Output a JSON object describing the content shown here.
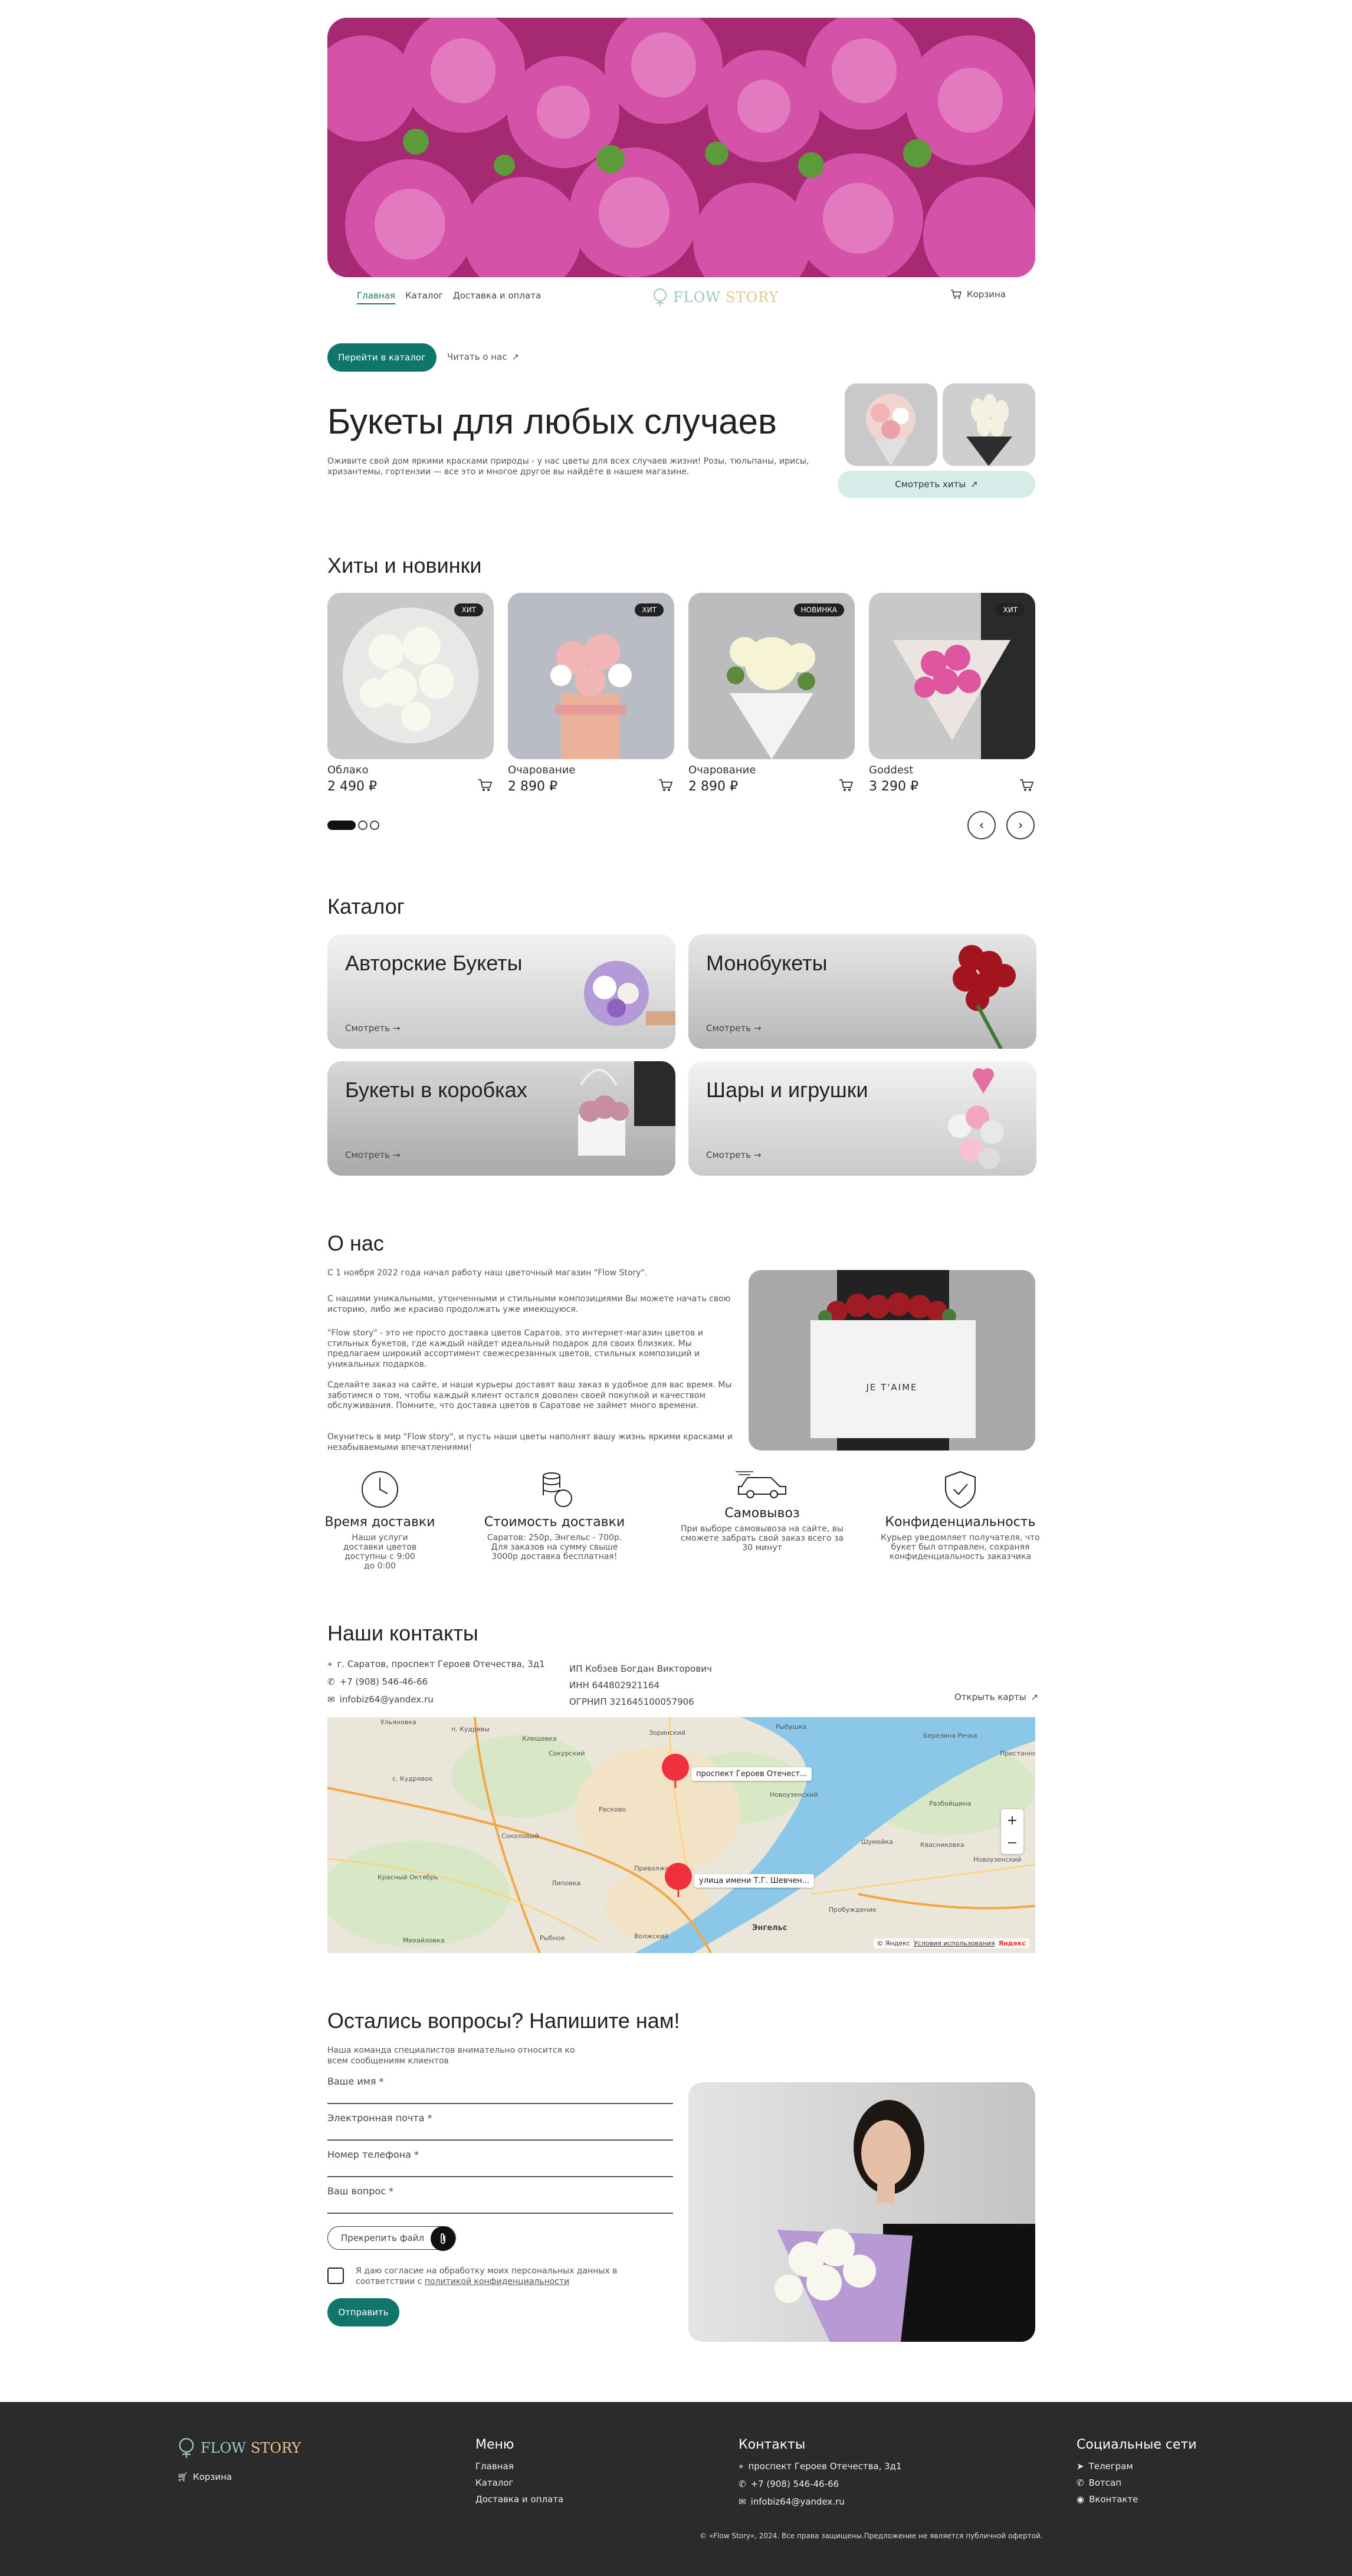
{
  "nav": {
    "items": [
      "Главная",
      "Каталог",
      "Доставка и оплата"
    ],
    "logo_flow": "FLOW",
    "logo_story": "STORY",
    "cart": "Корзина"
  },
  "hero": {
    "catalog_button": "Перейти в каталог",
    "about_link": "Читать о нас",
    "title": "Букеты для любых случаев",
    "subtitle": "Оживите свой дом яркими красками природы - у нас цветы для всех случаев жизни! Розы, тюльпаны, ирисы, хризантемы, гортензии — все это и многое другое вы найдёте в нашем магазине.",
    "hits_button": "Смотреть хиты"
  },
  "hits": {
    "title": "Хиты и новинки",
    "products": [
      {
        "name": "Облако",
        "price": "2 490 ₽",
        "badge": "ХИТ"
      },
      {
        "name": "Очарование",
        "price": "2 890 ₽",
        "badge": "ХИТ"
      },
      {
        "name": "Очарование",
        "price": "2 890 ₽",
        "badge": "НОВИНКА"
      },
      {
        "name": "Goddest",
        "price": "3 290 ₽",
        "badge": "ХИТ"
      }
    ]
  },
  "catalog": {
    "title": "Каталог",
    "link": "Смотреть",
    "categories": [
      "Авторские Букеты",
      "Монобукеты",
      "Букеты в коробках",
      "Шары и игрушки"
    ]
  },
  "about": {
    "title": "О нас",
    "p1": "С 1 ноября 2022 года начал работу наш цветочный магазин \"Flow Story\".",
    "p2": "С нашими уникальными, утонченными и стильными композициями Вы можете начать свою историю, либо же красиво продолжать уже имеющуюся.",
    "p3": "\"Flow story\" - это не просто доставка цветов Саратов, это интернет-магазин цветов и стильных букетов, где каждый найдет идеальный подарок для своих близких. Мы предлагаем широкий ассортимент свежесрезанных цветов, стильных композиций и уникальных подарков.",
    "p4": "Сделайте заказ на сайте, и наши курьеры доставят ваш заказ в удобное для вас время. Мы заботимся о том, чтобы каждый клиент остался доволен своей покупкой и качеством обслуживания. Помните, что доставка цветов в Саратове не займет много времени.",
    "p5": "Окунитесь в мир \"Flow story\", и пусть наши цветы наполнят вашу жизнь яркими красками и незабываемыми впечатлениями!",
    "box_text": "JE T'AIME",
    "features": [
      {
        "title": "Время доставки",
        "desc": "Наши услуги доставки цветов доступны с 9:00 до 0:00"
      },
      {
        "title": "Стоимость доставки",
        "desc": "Саратов: 250р, Энгельс - 700р. Для заказов на сумму свыше 3000р доставка бесплатная!"
      },
      {
        "title": "Самовывоз",
        "desc": "При выборе самовывоза на сайте, вы сможете забрать свой заказ всего за 30 минут"
      },
      {
        "title": "Конфиденциальность",
        "desc": "Курьер уведомляет получателя, что букет был отправлен, сохраняя конфиденциальность заказчика"
      }
    ]
  },
  "contacts": {
    "title": "Наши контакты",
    "address": "г. Саратов, проспект Героев Отечества, 3д1",
    "phone": "+7 (908) 546-46-66",
    "email": "infobiz64@yandex.ru",
    "ip": "ИП Кобзев Богдан Викторович",
    "inn": "ИНН 644802921164",
    "ogrn": "ОГРНИП 321645100057906",
    "open_map": "Открыть карты",
    "map": {
      "pin1": "проспект Героев Отечест...",
      "pin2": "улица имени Т.Г. Шевчен...",
      "places": [
        "Ульяновка",
        "Зоринский",
        "Рыбушка",
        "Березина Речка",
        "п. Кудрявы",
        "с. Кудрявое",
        "Сокурский",
        "Расково",
        "Клещевка",
        "Новоузенский",
        "Соколовый",
        "Пристанное",
        "Разбойщина",
        "Приволжский",
        "Новоузенский",
        "Шумейка",
        "Квасниковка",
        "Красный Октябрь",
        "Михайловка",
        "Рыбное",
        "Пробуждение",
        "Волжский",
        "Липовка",
        "Энгельс"
      ],
      "copyright": "© Яндекс",
      "terms": "Условия использования",
      "brand": "Яндекс"
    }
  },
  "form": {
    "title": "Остались вопросы? Напишите нам!",
    "subtitle": "Наша команда специалистов внимательно относится ко всем сообщениям клиентов",
    "name": "Ваше имя *",
    "email": "Электронная почта *",
    "phone": "Номер телефона *",
    "question": "Ваш вопрос *",
    "attach": "Прекрепить файл",
    "consent_prefix": "Я даю согласие на обработку моих персональных данных в соответствии с",
    "consent_link": "политикой конфиденциальности",
    "submit": "Отправить"
  },
  "footer": {
    "logo_flow": "FLOW",
    "logo_story": "STORY",
    "cart": "Корзина",
    "menu_title": "Меню",
    "menu": [
      "Главная",
      "Каталог",
      "Доставка и оплата"
    ],
    "contacts_title": "Контакты",
    "address": "проспект Героев Отечества, 3д1",
    "phone": "+7 (908) 546-46-66",
    "email": "infobiz64@yandex.ru",
    "social_title": "Социальные сети",
    "social": [
      "Телеграм",
      "Вотсап",
      "Вконтакте"
    ],
    "copyright": "© «Flow Story», 2024. Все права защищены.Предложение не является публичной офертой."
  },
  "colors": {
    "accent": "#11766a",
    "accent_light": "#d5ece9",
    "footer": "#2b2b2b"
  }
}
